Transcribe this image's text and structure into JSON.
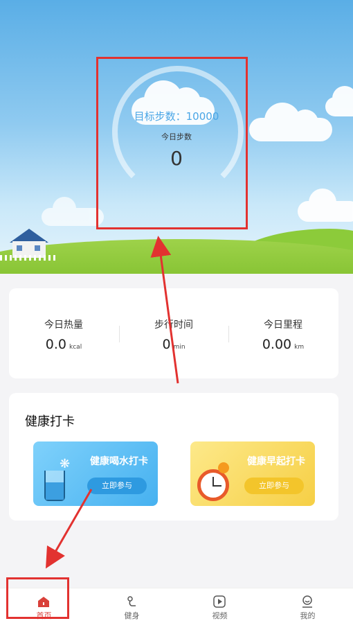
{
  "hero": {
    "goal_text": "目标步数：10000",
    "today_label": "今日步数",
    "today_value": "0"
  },
  "stats": [
    {
      "label": "今日热量",
      "value": "0.0",
      "unit": "kcal"
    },
    {
      "label": "步行时间",
      "value": "0",
      "unit": "min"
    },
    {
      "label": "今日里程",
      "value": "0.00",
      "unit": "km"
    }
  ],
  "checkin": {
    "title": "健康打卡",
    "cards": [
      {
        "title": "健康喝水打卡",
        "button": "立即参与",
        "icon": "water-glass-icon"
      },
      {
        "title": "健康早起打卡",
        "button": "立即参与",
        "icon": "alarm-clock-icon"
      }
    ]
  },
  "tabbar": {
    "items": [
      {
        "label": "首页",
        "icon": "home-icon",
        "active": true
      },
      {
        "label": "健身",
        "icon": "fitness-icon",
        "active": false
      },
      {
        "label": "视频",
        "icon": "video-play-icon",
        "active": false
      },
      {
        "label": "我的",
        "icon": "profile-icon",
        "active": false
      }
    ]
  },
  "colors": {
    "accent_blue": "#4aa6e6",
    "active_tab": "#d9403a",
    "annotation_red": "#e23230"
  }
}
